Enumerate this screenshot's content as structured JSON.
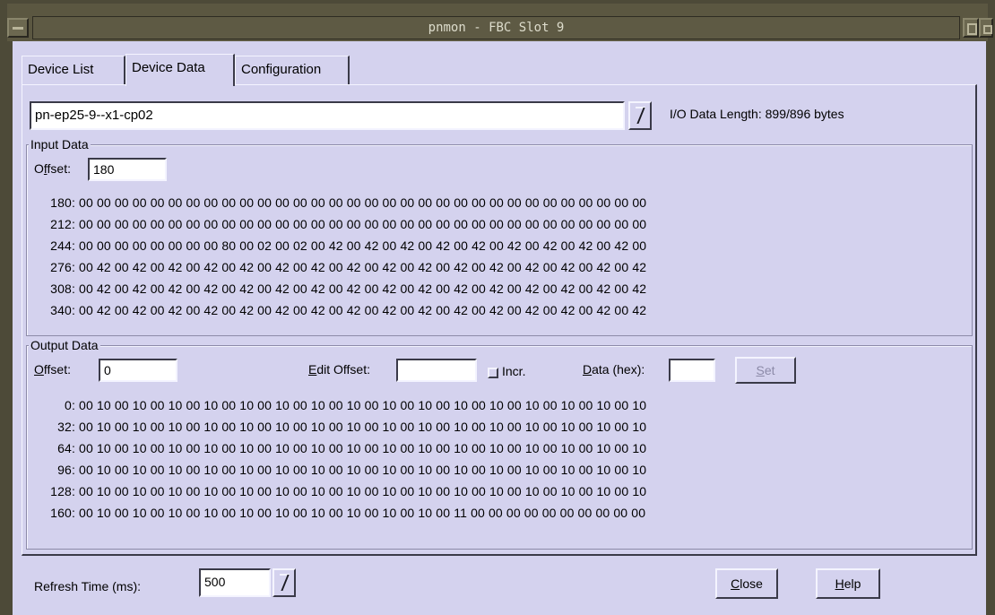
{
  "window": {
    "title": "pnmon - FBC Slot 9"
  },
  "tabs": [
    {
      "label": "Device List"
    },
    {
      "label": "Device Data"
    },
    {
      "label": "Configuration"
    }
  ],
  "device": {
    "selected": "pn-ep25-9--x1-cp02",
    "io_length_label": "I/O Data Length: 899/896 bytes"
  },
  "input": {
    "group_title": "Input Data",
    "offset_label_pre": "O",
    "offset_label_ul": "f",
    "offset_label_post": "fset:",
    "offset_value": "180",
    "rows": [
      {
        "offset": "180:",
        "bytes": "00 00 00 00 00 00 00 00 00 00 00 00 00 00 00 00 00 00 00 00 00 00 00 00 00 00 00 00 00 00 00 00"
      },
      {
        "offset": "212:",
        "bytes": "00 00 00 00 00 00 00 00 00 00 00 00 00 00 00 00 00 00 00 00 00 00 00 00 00 00 00 00 00 00 00 00"
      },
      {
        "offset": "244:",
        "bytes": "00 00 00 00 00 00 00 00 80 00 02 00 02 00 42 00 42 00 42 00 42 00 42 00 42 00 42 00 42 00 42 00"
      },
      {
        "offset": "276:",
        "bytes": "00 42 00 42 00 42 00 42 00 42 00 42 00 42 00 42 00 42 00 42 00 42 00 42 00 42 00 42 00 42 00 42"
      },
      {
        "offset": "308:",
        "bytes": "00 42 00 42 00 42 00 42 00 42 00 42 00 42 00 42 00 42 00 42 00 42 00 42 00 42 00 42 00 42 00 42"
      },
      {
        "offset": "340:",
        "bytes": "00 42 00 42 00 42 00 42 00 42 00 42 00 42 00 42 00 42 00 42 00 42 00 42 00 42 00 42 00 42 00 42"
      }
    ]
  },
  "output": {
    "group_title": "Output Data",
    "offset_value": "0",
    "edit_offset_label": "Edit Offset:",
    "edit_offset_value": "",
    "incr_label": "Incr.",
    "data_hex_label": "Data (hex):",
    "data_hex_value": "",
    "set_label": "Set",
    "rows": [
      {
        "offset": "0:",
        "bytes": "00 10 00 10 00 10 00 10 00 10 00 10 00 10 00 10 00 10 00 10 00 10 00 10 00 10 00 10 00 10 00 10"
      },
      {
        "offset": "32:",
        "bytes": "00 10 00 10 00 10 00 10 00 10 00 10 00 10 00 10 00 10 00 10 00 10 00 10 00 10 00 10 00 10 00 10"
      },
      {
        "offset": "64:",
        "bytes": "00 10 00 10 00 10 00 10 00 10 00 10 00 10 00 10 00 10 00 10 00 10 00 10 00 10 00 10 00 10 00 10"
      },
      {
        "offset": "96:",
        "bytes": "00 10 00 10 00 10 00 10 00 10 00 10 00 10 00 10 00 10 00 10 00 10 00 10 00 10 00 10 00 10 00 10"
      },
      {
        "offset": "128:",
        "bytes": "00 10 00 10 00 10 00 10 00 10 00 10 00 10 00 10 00 10 00 10 00 10 00 10 00 10 00 10 00 10 00 10"
      },
      {
        "offset": "160:",
        "bytes": "00 10 00 10 00 10 00 10 00 10 00 10 00 10 00 10 00 10 00 10 00 11 00 00 00 00 00 00 00 00 00 00"
      }
    ]
  },
  "footer": {
    "refresh_label": "Refresh Time (ms):",
    "refresh_value": "500",
    "close_label": "Close",
    "help_label": "Help"
  },
  "colors": {
    "dialog_bg": "#d4d2ee",
    "frame": "#4d4a38",
    "title_text": "#dddccc"
  }
}
